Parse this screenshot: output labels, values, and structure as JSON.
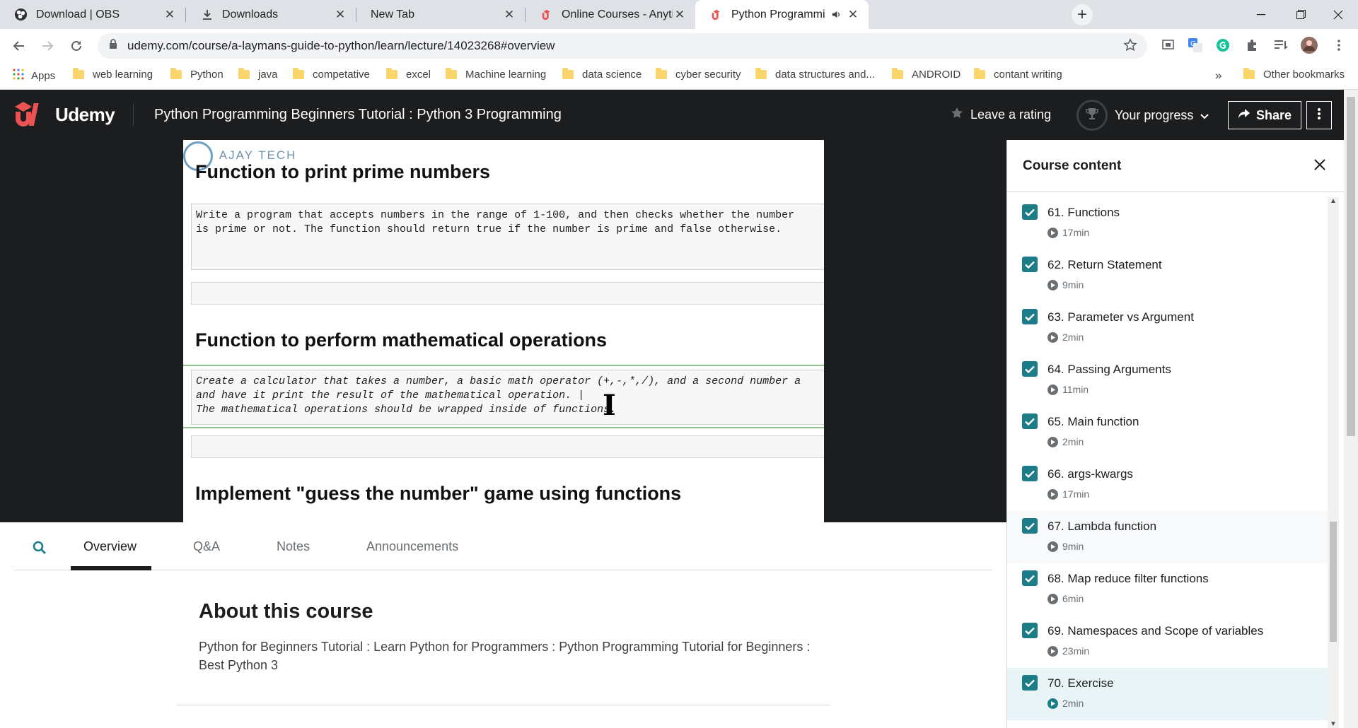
{
  "browser": {
    "tabs": [
      {
        "title": "Download | OBS",
        "icon": "obs-icon"
      },
      {
        "title": "Downloads",
        "icon": "download-icon"
      },
      {
        "title": "New Tab",
        "icon": ""
      },
      {
        "title": "Online Courses - Anytime, Anywhere",
        "icon": "udemy-icon"
      },
      {
        "title": "Python Programming Beginners",
        "icon": "udemy-icon",
        "active": true
      }
    ],
    "url": "udemy.com/course/a-laymans-guide-to-python/learn/lecture/14023268#overview",
    "bookmarks": [
      {
        "label": "Apps"
      },
      {
        "label": "web learning"
      },
      {
        "label": "Python"
      },
      {
        "label": "java"
      },
      {
        "label": "competative"
      },
      {
        "label": "excel"
      },
      {
        "label": "Machine learning"
      },
      {
        "label": "data science"
      },
      {
        "label": "cyber security"
      },
      {
        "label": "data structures and..."
      },
      {
        "label": "ANDROID"
      },
      {
        "label": "contant writing"
      }
    ],
    "bookmarks_overflow": "»",
    "other_bookmarks": "Other bookmarks"
  },
  "header": {
    "brand": "Udemy",
    "course_title": "Python Programming Beginners Tutorial : Python 3 Programming",
    "rating_label": "Leave a rating",
    "progress_label": "Your progress",
    "share_label": "Share",
    "brand_color": "#a435f0"
  },
  "slide": {
    "watermark": "AJAY TECH",
    "section1_title": "Function to print prime numbers",
    "section1_code": "Write a program that accepts numbers in the range of 1-100, and then checks whether the number\nis prime or not. The function should return true if the number is prime and false otherwise.",
    "section2_title": "Function to perform mathematical operations",
    "section2_code": "Create a calculator that takes a number, a basic math operator (+,-,*,/), and a second number a\nand have it print the result of the mathematical operation. |\nThe mathematical operations should be wrapped inside of functions.",
    "section3_title": "Implement \"guess the number\" game using functions"
  },
  "dashboard": {
    "tabs": [
      "Overview",
      "Q&A",
      "Notes",
      "Announcements"
    ],
    "active_tab": "Overview",
    "about_title": "About this course",
    "about_text": "Python for Beginners Tutorial : Learn Python for Programmers : Python Programming Tutorial for Beginners : Best Python 3"
  },
  "sidebar": {
    "title": "Course content",
    "lectures": [
      {
        "title": "61. Functions",
        "duration": "17min",
        "completed": true
      },
      {
        "title": "62. Return Statement",
        "duration": "9min",
        "completed": true
      },
      {
        "title": "63. Parameter vs Argument",
        "duration": "2min",
        "completed": true
      },
      {
        "title": "64. Passing Arguments",
        "duration": "11min",
        "completed": true
      },
      {
        "title": "65. Main function",
        "duration": "2min",
        "completed": true
      },
      {
        "title": "66. args-kwargs",
        "duration": "17min",
        "completed": true
      },
      {
        "title": "67. Lambda function",
        "duration": "9min",
        "completed": true
      },
      {
        "title": "68. Map reduce filter functions",
        "duration": "6min",
        "completed": true
      },
      {
        "title": "69. Namespaces and Scope of variables",
        "duration": "23min",
        "completed": true
      },
      {
        "title": "70. Exercise",
        "duration": "2min",
        "completed": true,
        "current": true
      }
    ],
    "accent_color": "#1c7c87"
  }
}
